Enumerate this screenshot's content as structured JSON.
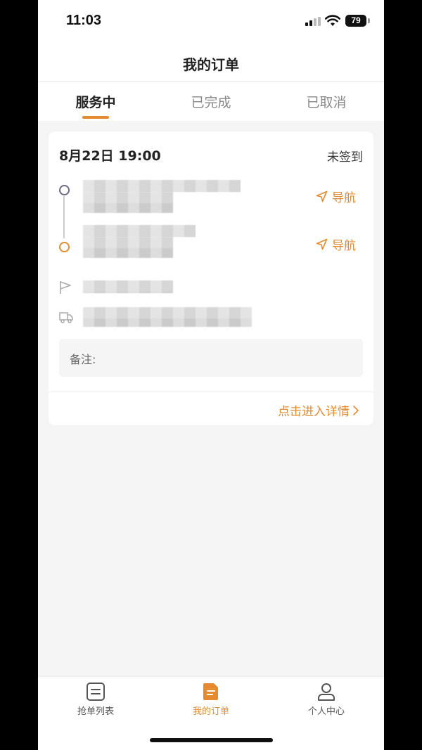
{
  "status_bar": {
    "time": "11:03",
    "battery": "79",
    "icons": [
      "signal-icon",
      "wifi-icon",
      "battery-icon"
    ]
  },
  "header": {
    "title": "我的订单"
  },
  "tabs": [
    {
      "label": "服务中",
      "active": true
    },
    {
      "label": "已完成",
      "active": false
    },
    {
      "label": "已取消",
      "active": false
    }
  ],
  "order_card": {
    "datetime": "8月22日 19:00",
    "status": "未签到",
    "navigate_label": "导航",
    "remark_label": "备注:",
    "detail_link": "点击进入详情"
  },
  "bottom_nav": [
    {
      "label": "抢单列表",
      "icon": "list-icon",
      "active": false
    },
    {
      "label": "我的订单",
      "icon": "order-icon",
      "active": true
    },
    {
      "label": "个人中心",
      "icon": "user-icon",
      "active": false
    }
  ],
  "colors": {
    "accent": "#e58a2f",
    "background": "#f5f5f5",
    "card": "#ffffff",
    "start_dot": "#6a6a86"
  }
}
